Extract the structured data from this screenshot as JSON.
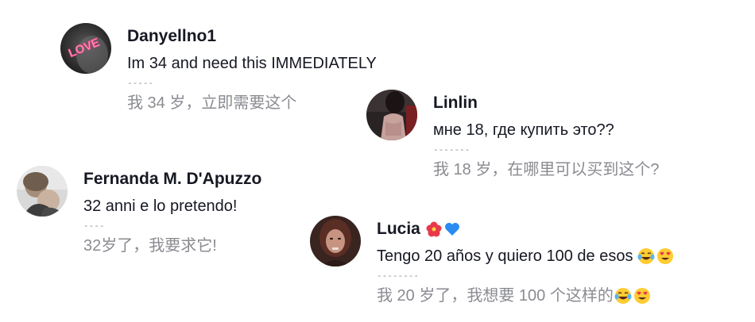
{
  "comments": [
    {
      "username": "Danyellno1",
      "text": "Im 34 and need this IMMEDIATELY",
      "divider": "-----",
      "translation": "我 34 岁，立即需要这个",
      "avatar_label": "LOVE"
    },
    {
      "username": "Linlin",
      "text": "мне 18, где купить это??",
      "divider": "-------",
      "translation": "我 18 岁，在哪里可以买到这个?"
    },
    {
      "username": "Fernanda M. D'Apuzzo",
      "text": "32 anni e lo pretendo!",
      "divider": "----",
      "translation": "32岁了，我要求它!"
    },
    {
      "username": "Lucia",
      "username_emojis": [
        "hibiscus-emoji",
        "blue-heart-emoji"
      ],
      "text": "Tengo 20 años y quiero 100 de esos",
      "text_emojis": [
        "tears-of-joy-emoji",
        "heart-eyes-emoji"
      ],
      "divider": "--------",
      "translation": "我 20 岁了，我想要 100 个这样的",
      "translation_emojis": [
        "tears-of-joy-emoji",
        "heart-eyes-emoji"
      ]
    }
  ],
  "colors": {
    "username": "#161823",
    "text": "#161823",
    "translation": "#8a8b91",
    "background": "#ffffff"
  }
}
